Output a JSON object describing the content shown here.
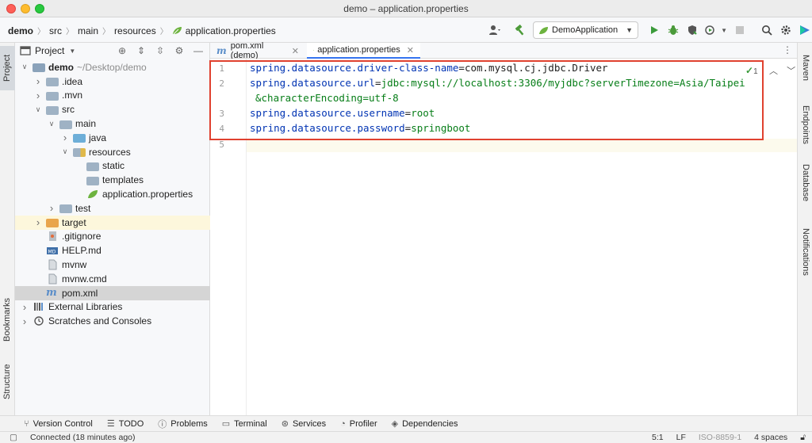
{
  "window": {
    "title": "demo – application.properties"
  },
  "breadcrumb": [
    "demo",
    "src",
    "main",
    "resources",
    "application.properties"
  ],
  "toolbar": {
    "run_config": "DemoApplication"
  },
  "left_tabs": [
    "Project",
    "Bookmarks",
    "Structure"
  ],
  "right_tabs": [
    "Maven",
    "Endpoints",
    "Database",
    "Notifications"
  ],
  "project": {
    "header": "Project",
    "tree": [
      {
        "label": "demo",
        "hint": "~/Desktop/demo",
        "depth": 0,
        "arrow": "open",
        "icon": "module-folder"
      },
      {
        "label": ".idea",
        "depth": 1,
        "arrow": "closed",
        "icon": "folder"
      },
      {
        "label": ".mvn",
        "depth": 1,
        "arrow": "closed",
        "icon": "folder"
      },
      {
        "label": "src",
        "depth": 1,
        "arrow": "open",
        "icon": "folder"
      },
      {
        "label": "main",
        "depth": 2,
        "arrow": "open",
        "icon": "folder"
      },
      {
        "label": "java",
        "depth": 3,
        "arrow": "closed",
        "icon": "source-folder"
      },
      {
        "label": "resources",
        "depth": 3,
        "arrow": "open",
        "icon": "resources-folder"
      },
      {
        "label": "static",
        "depth": 4,
        "arrow": "none",
        "icon": "folder"
      },
      {
        "label": "templates",
        "depth": 4,
        "arrow": "none",
        "icon": "folder"
      },
      {
        "label": "application.properties",
        "depth": 4,
        "arrow": "none",
        "icon": "spring-leaf"
      },
      {
        "label": "test",
        "depth": 2,
        "arrow": "closed",
        "icon": "folder"
      },
      {
        "label": "target",
        "depth": 1,
        "arrow": "closed",
        "icon": "excluded-folder"
      },
      {
        "label": ".gitignore",
        "depth": 1,
        "arrow": "none",
        "icon": "gitignore-file"
      },
      {
        "label": "HELP.md",
        "depth": 1,
        "arrow": "none",
        "icon": "markdown-file"
      },
      {
        "label": "mvnw",
        "depth": 1,
        "arrow": "none",
        "icon": "text-file"
      },
      {
        "label": "mvnw.cmd",
        "depth": 1,
        "arrow": "none",
        "icon": "text-file"
      },
      {
        "label": "pom.xml",
        "depth": 1,
        "arrow": "none",
        "icon": "maven-file"
      },
      {
        "label": "External Libraries",
        "depth": 0,
        "arrow": "closed",
        "icon": "library"
      },
      {
        "label": "Scratches and Consoles",
        "depth": 0,
        "arrow": "closed",
        "icon": "scratches"
      }
    ]
  },
  "tabs": [
    {
      "label": "pom.xml (demo)",
      "active": false
    },
    {
      "label": "application.properties",
      "active": true
    }
  ],
  "editor": {
    "inspection_count": "1",
    "lines": [
      {
        "num": "1",
        "key": "spring.datasource.driver-class-name",
        "value": "com.mysql.cj.jdbc.Driver"
      },
      {
        "num": "2",
        "key": "spring.datasource.url",
        "value": "jdbc:mysql://localhost:3306/myjdbc?serverTimezone=Asia/Taipei",
        "continuation": "&characterEncoding=utf-8"
      },
      {
        "num": "3",
        "key": "spring.datasource.username",
        "value": "root"
      },
      {
        "num": "4",
        "key": "spring.datasource.password",
        "value": "springboot"
      },
      {
        "num": "5",
        "key": "",
        "value": ""
      }
    ]
  },
  "bottom_tools": [
    "Version Control",
    "TODO",
    "Problems",
    "Terminal",
    "Services",
    "Profiler",
    "Dependencies"
  ],
  "status": {
    "message": "Connected (18 minutes ago)",
    "position": "5:1",
    "line_sep": "LF",
    "encoding": "ISO-8859-1",
    "indent": "4 spaces"
  }
}
